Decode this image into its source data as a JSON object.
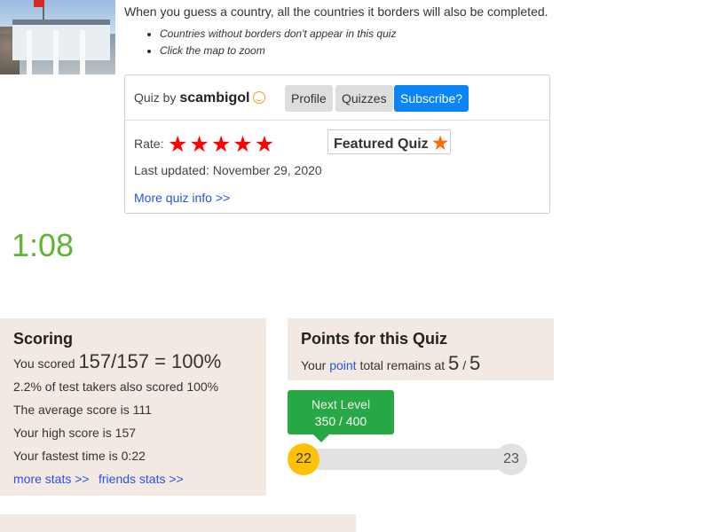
{
  "intro": "When you guess a country, all the countries it borders will also be completed.",
  "notes": [
    "Countries without borders don't appear in this quiz",
    "Click the map to zoom"
  ],
  "info": {
    "quiz_by_label": "Quiz by",
    "author": "scambigol",
    "buttons": {
      "profile": "Profile",
      "quizzes": "Quizzes",
      "subscribe": "Subscribe?"
    },
    "rate_label": "Rate:",
    "rating_stars": 5,
    "featured_label": "Featured Quiz",
    "last_updated": "Last updated: November 29, 2020",
    "more_info": "More quiz info >>"
  },
  "timer": "1:08",
  "scoring": {
    "title": "Scoring",
    "you_scored_label": "You scored",
    "score": "157/157 = 100%",
    "pct_takers": "2.2% of test takers also scored 100%",
    "average": "The average score is 111",
    "high": "Your high score is 157",
    "fastest": "Your fastest time is 0:22",
    "more_stats": "more stats >>",
    "friends_stats": "friends stats >>"
  },
  "points": {
    "title": "Points for this Quiz",
    "text_pre": "Your",
    "link": "point",
    "text_post": "total remains at",
    "remaining": "5",
    "sep": "/",
    "total": "5"
  },
  "level": {
    "next_label": "Next Level",
    "progress_text": "350 / 400",
    "current": "22",
    "next": "23",
    "progress_fraction": 0.0
  },
  "colors": {
    "accent_blue": "#0b84f5",
    "link": "#2b50e6",
    "timer_green": "#5fb336",
    "box_bg": "#f1e9e2",
    "star_red": "#ff0000",
    "level_gold": "#ffc107",
    "level_green": "#28a745"
  }
}
